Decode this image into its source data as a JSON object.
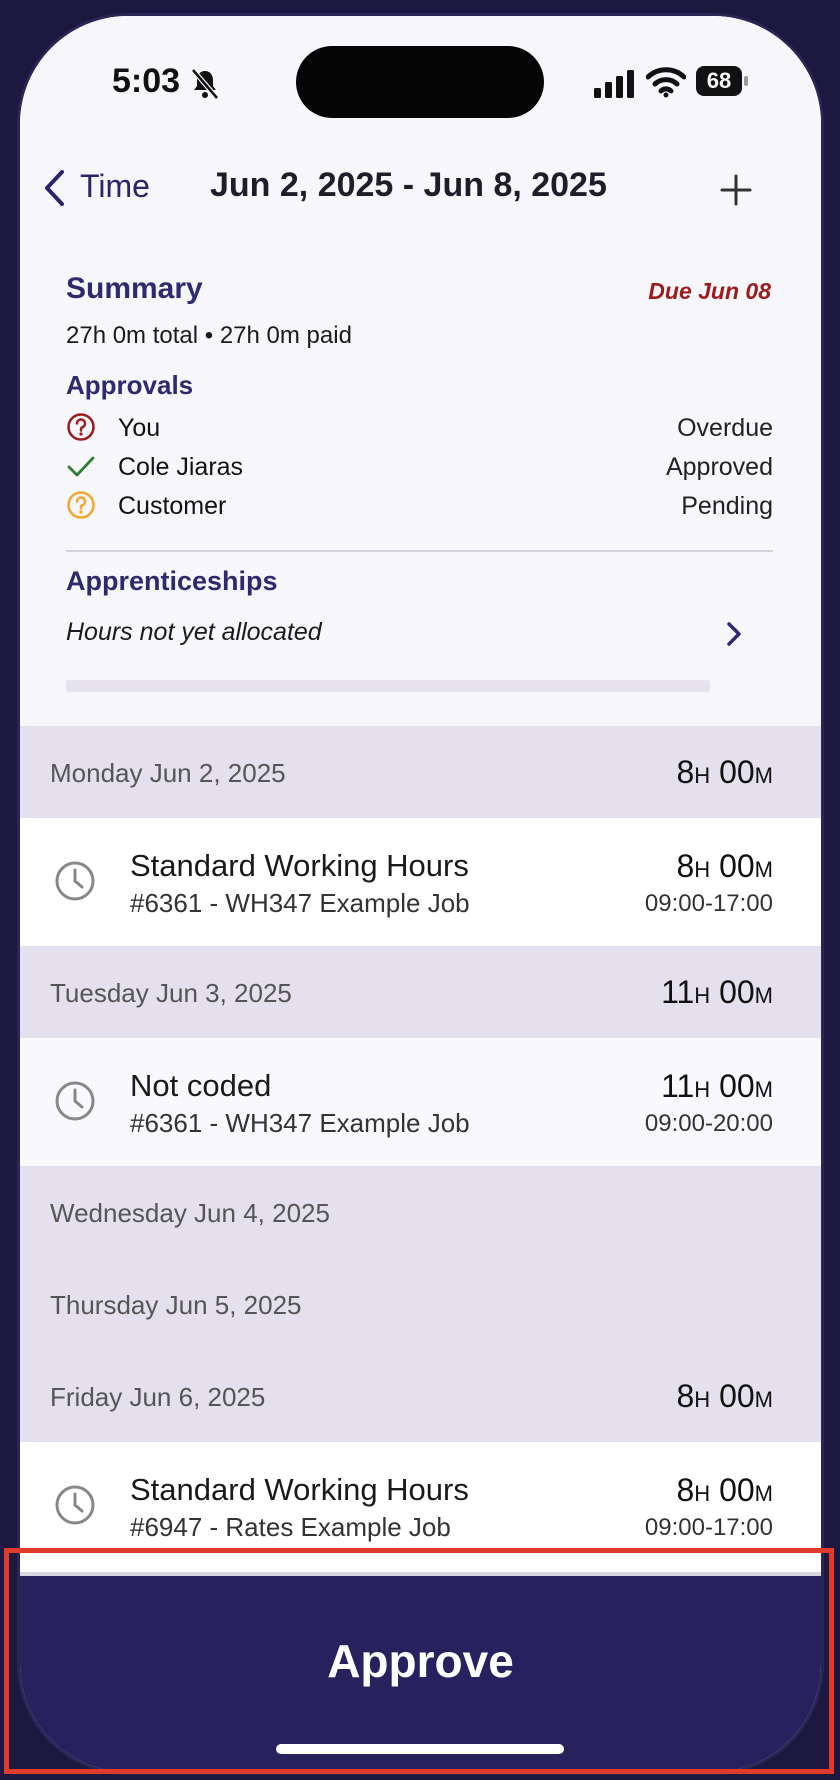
{
  "status_bar": {
    "time": "5:03",
    "battery": "68",
    "bell_icon": "bell-slash-icon",
    "signal_icon": "signal-icon",
    "wifi_icon": "wifi-icon"
  },
  "nav": {
    "back_label": "Time",
    "title": "Jun 2, 2025 - Jun 8, 2025",
    "back_icon": "chevron-left-icon",
    "add_icon": "plus-icon"
  },
  "summary": {
    "title": "Summary",
    "due": "Due Jun 08",
    "totals": "27h 0m total • 27h 0m paid",
    "approvals_title": "Approvals",
    "approvals": [
      {
        "name": "You",
        "status": "Overdue",
        "icon": "question-circle-icon",
        "color": "#9a1c1c"
      },
      {
        "name": "Cole Jiaras",
        "status": "Approved",
        "icon": "check-icon",
        "color": "#2e7d32"
      },
      {
        "name": "Customer",
        "status": "Pending",
        "icon": "question-circle-icon",
        "color": "#f0a830"
      }
    ],
    "apprenticeships_title": "Apprenticeships",
    "apprenticeships_text": "Hours not yet allocated",
    "apprenticeships_progress": 0
  },
  "days": [
    {
      "label": "Monday Jun 2, 2025",
      "hours": "8",
      "minutes": "00"
    },
    {
      "label": "Tuesday Jun 3, 2025",
      "hours": "11",
      "minutes": "00"
    },
    {
      "label": "Wednesday Jun 4, 2025"
    },
    {
      "label": "Thursday Jun 5, 2025"
    },
    {
      "label": "Friday Jun 6, 2025",
      "hours": "8",
      "minutes": "00"
    }
  ],
  "entries": [
    {
      "title": "Standard Working Hours",
      "job": "#6361 - WH347 Example Job",
      "hours": "8",
      "minutes": "00",
      "range": "09:00-17:00"
    },
    {
      "title": "Not coded",
      "job": "#6361 - WH347 Example Job",
      "hours": "11",
      "minutes": "00",
      "range": "09:00-20:00"
    },
    {
      "title": "Standard Working Hours",
      "job": "#6947 - Rates Example Job",
      "hours": "8",
      "minutes": "00",
      "range": "09:00-17:00"
    }
  ],
  "units": {
    "h": "H",
    "m": "M"
  },
  "approve_label": "Approve",
  "colors": {
    "brand": "#27225e",
    "section_heading": "#2e2a6e",
    "due": "#9a1c1c",
    "day_header_bg": "#e5e0ee"
  }
}
